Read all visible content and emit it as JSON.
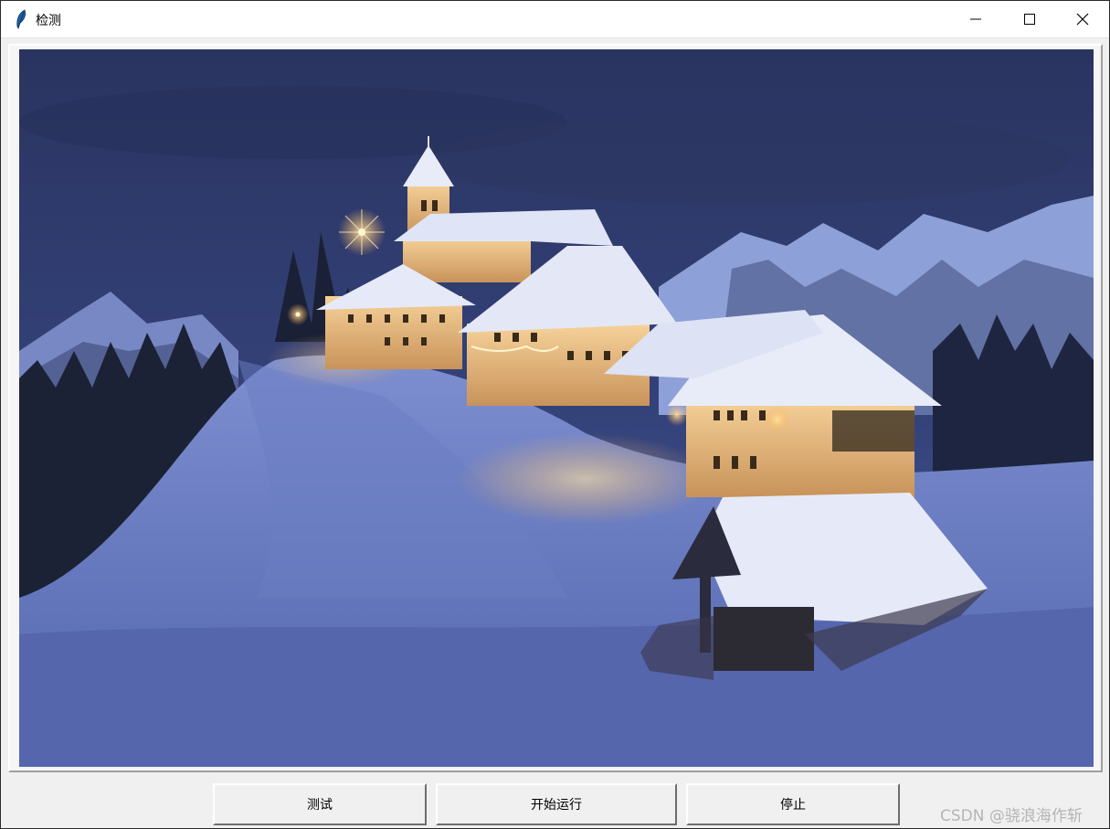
{
  "window": {
    "title": "检测",
    "app_icon": "feather-icon",
    "controls": [
      "minimize-icon",
      "maximize-icon",
      "close-icon"
    ]
  },
  "image_panel": {
    "content": "snowy-mountain-village-at-dusk-photo",
    "colors": {
      "sky": "#2d3868",
      "snow": "#6a7fc4",
      "light": "#ffd58a"
    }
  },
  "buttons": {
    "test_label": "测试",
    "start_label": "开始运行",
    "stop_label": "停止"
  },
  "watermark": "CSDN @骁浪海作斩"
}
